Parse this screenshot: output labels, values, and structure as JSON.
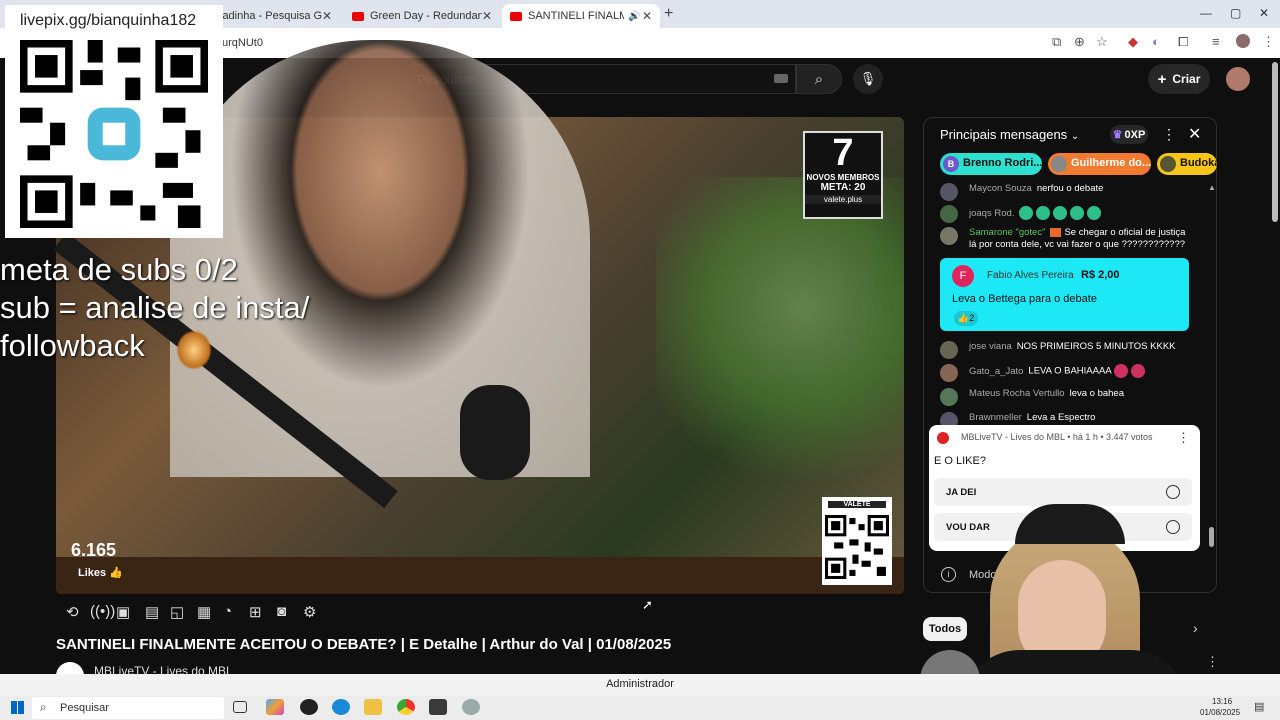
{
  "browser": {
    "tabs": [
      {
        "label": "jadinha - Pesquisa Google",
        "active": false
      },
      {
        "label": "Green Day - Redundant [Officia",
        "active": false
      },
      {
        "label": "SANTINELI FINALMENTE AC",
        "active": true
      }
    ],
    "url_fragment": "urqNUt0"
  },
  "overlay": {
    "url": "livepix.gg/bianquinha182",
    "text": "meta de subs 0/2\nsub = analise de insta/\nfollowback"
  },
  "header": {
    "search_placeholder": "Pesquisar",
    "create_label": "Criar"
  },
  "video": {
    "badge_number": "7",
    "badge_line1": "NOVOS MEMBROS",
    "badge_meta": "META: 20",
    "badge_site": "valete.plus",
    "qr_brand": "VALETE",
    "likes_count": "6.165",
    "likes_label": "Likes",
    "title": "SANTINELI FINALMENTE ACEITOU O DEBATE? | E Detalhe | Arthur do Val | 01/08/2025",
    "channel": "MBLiveTV - Lives do MBL"
  },
  "chat": {
    "title": "Principais mensagens",
    "xp": "0XP",
    "pills": [
      {
        "initial": "B",
        "name": "Brenno Rodri...",
        "color": "#2ee0d0"
      },
      {
        "initial": "",
        "name": "Guilherme do...",
        "color": "#f07a30"
      },
      {
        "initial": "",
        "name": "Budoka",
        "color": "#f5c518"
      }
    ],
    "messages": [
      {
        "author": "Maycon Souza",
        "text": "nerfou o debate",
        "mod": false
      },
      {
        "author": "joaqs Rod.",
        "text": "",
        "mod": false,
        "emojis": 5
      },
      {
        "author": "Samarone \"gotec\"",
        "text": "Se chegar o oficial de justiça lá por conta dele, vc vai fazer o que ????????????",
        "mod": true
      },
      {
        "author": "jose viana",
        "text": "NOS PRIMEIROS 5 MINUTOS KKKK",
        "mod": false
      },
      {
        "author": "Gato_a_Jato",
        "text": "LEVA O BAHIAAAA",
        "mod": false
      },
      {
        "author": "Mateus Rocha Vertullo",
        "text": "leva o bahea",
        "mod": false
      },
      {
        "author": "Brawnmeller",
        "text": "Leva a Espectro",
        "mod": false
      }
    ],
    "superchat": {
      "initial": "F",
      "name": "Fabio Alves Pereira",
      "amount": "R$ 2,00",
      "text": "Leva o Bettega para o debate",
      "likes": "2"
    },
    "poll": {
      "header": "MBLiveTV - Lives do MBL • há 1 h • 3.447 votos",
      "question": "E O LIKE?",
      "options": [
        "JA DEI",
        "VOU DAR"
      ]
    },
    "mode_label": "Modo"
  },
  "filters": {
    "all_label": "Todos"
  },
  "system": {
    "admin_label": "Administrador",
    "taskbar_search": "Pesquisar",
    "time": "13:16",
    "date": "01/08/2025"
  },
  "colors": {
    "youtube_red": "#ff0000",
    "superchat": "#1de9f6",
    "moderator_green": "#5cc15c"
  }
}
